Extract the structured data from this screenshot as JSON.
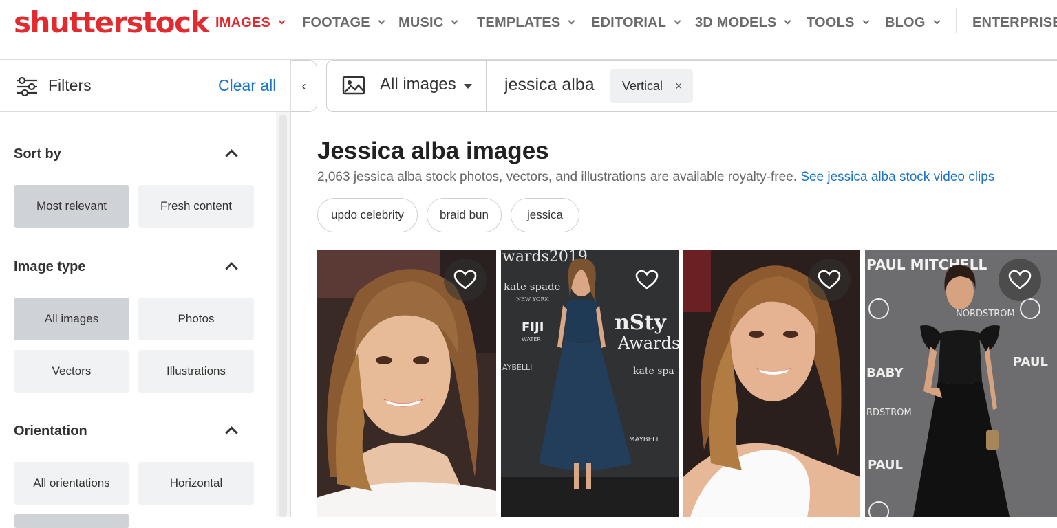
{
  "brand": {
    "logo_text": "shutterstock",
    "accent": "#e32a2f",
    "link": "#1a73c8"
  },
  "nav": [
    {
      "label": "IMAGES",
      "active": true
    },
    {
      "label": "FOOTAGE"
    },
    {
      "label": "MUSIC"
    },
    {
      "label": "TEMPLATES"
    },
    {
      "label": "EDITORIAL"
    },
    {
      "label": "3D MODELS"
    },
    {
      "label": "TOOLS"
    },
    {
      "label": "BLOG"
    },
    {
      "label": "ENTERPRISE"
    }
  ],
  "filters": {
    "label": "Filters",
    "clear_all": "Clear all",
    "collapse_icon": "‹"
  },
  "search": {
    "type_label": "All images",
    "query": "jessica alba",
    "chip": "Vertical",
    "chip_remove": "×"
  },
  "sidebar": {
    "sort": {
      "title": "Sort by",
      "options": [
        "Most relevant",
        "Fresh content"
      ]
    },
    "image_type": {
      "title": "Image type",
      "options": [
        "All images",
        "Photos",
        "Vectors",
        "Illustrations"
      ]
    },
    "orientation": {
      "title": "Orientation",
      "options": [
        "All orientations",
        "Horizontal"
      ]
    }
  },
  "results": {
    "heading": "Jessica alba images",
    "summary": "2,063 jessica alba stock photos, vectors, and illustrations are available royalty-free.",
    "video_link": "See jessica alba stock video clips",
    "related": [
      "updo celebrity",
      "braid bun",
      "jessica"
    ]
  },
  "tiles": [
    {
      "icon": "heart-icon"
    },
    {
      "icon": "heart-icon",
      "caption_top": "wards2019",
      "texts": [
        "kate spade",
        "NEW YORK",
        "FIJI",
        "WATER",
        "AYBELLI",
        "nSty",
        "Awards",
        "kate spa",
        "MAYBELL"
      ]
    },
    {
      "icon": "heart-icon"
    },
    {
      "icon": "heart-icon",
      "texts": [
        "PAUL MITCHELL",
        "NORDSTROM",
        "PAUL",
        "BABY",
        "RDSTROM",
        "PAUL"
      ]
    }
  ]
}
